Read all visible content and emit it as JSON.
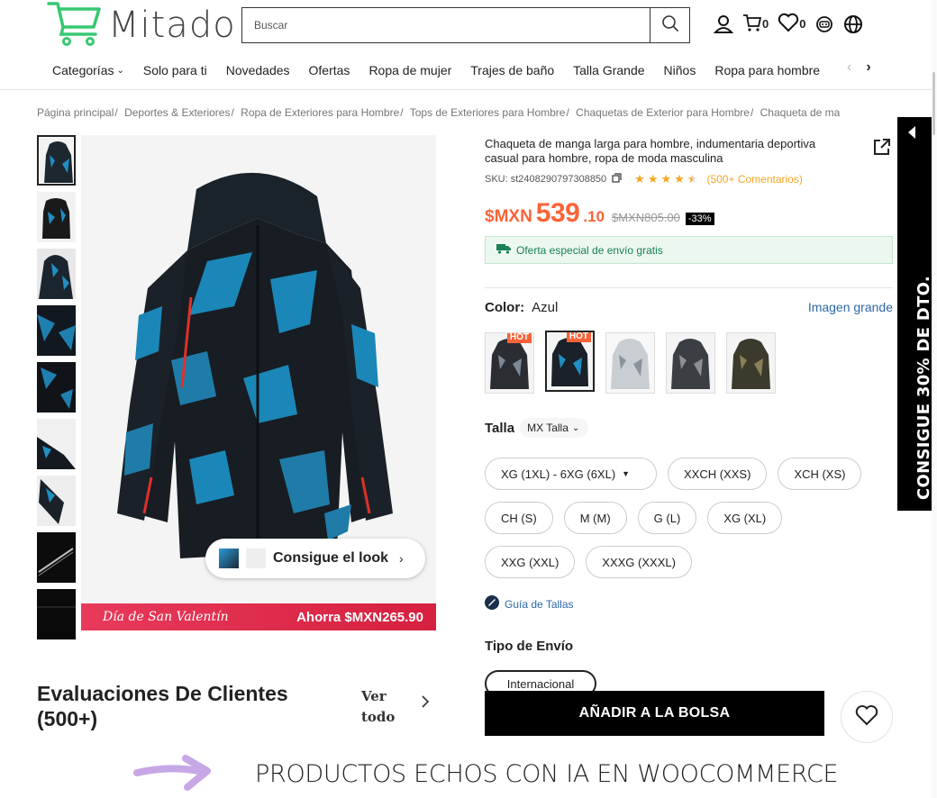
{
  "header": {
    "logo_text": "Mitado",
    "search_placeholder": "Buscar",
    "cart_count": "0",
    "wish_count": "0"
  },
  "nav": {
    "items": [
      "Categorías",
      "Solo para ti",
      "Novedades",
      "Ofertas",
      "Ropa de mujer",
      "Trajes de baño",
      "Talla Grande",
      "Niños",
      "Ropa para hombre"
    ]
  },
  "breadcrumb": [
    "Página principal",
    "Deportes & Exteriores",
    "Ropa de Exteriores para Hombre",
    "Tops de Exteriores para Hombre",
    "Chaquetas de Exterior para Hombre",
    "Chaqueta de ma"
  ],
  "gallery": {
    "promo_left": "Día de San Valentín",
    "promo_right": "Ahorra $MXN265.90",
    "look_label": "Consigue el look"
  },
  "product": {
    "title": "Chaqueta de manga larga para hombre, indumentaria deportiva casual para hombre, ropa de moda masculina",
    "sku": "SKU: st2408290797308850",
    "rating": 4.5,
    "reviews_label": "(500+ Comentarios)",
    "price_currency": "$MXN",
    "price_int": "539",
    "price_dec": ".10",
    "price_old": "$MXN805.00",
    "discount": "-33%",
    "shipping_offer": "Oferta especial de envío gratis",
    "color_label": "Color:",
    "color_value": "Azul",
    "big_image_link": "Imagen grande",
    "hot_badge": "HOT",
    "size_label": "Talla",
    "size_system": "MX Talla",
    "sizes": [
      "XG (1XL) - 6XG (6XL)",
      "XXCH (XXS)",
      "XCH (XS)",
      "CH (S)",
      "M (M)",
      "G (L)",
      "XG (XL)",
      "XXG (XXL)",
      "XXXG (XXXL)"
    ],
    "size_guide": "Guía de Tallas",
    "ship_type_label": "Tipo de Envío",
    "ship_type_value": "Internacional",
    "add_to_bag": "AÑADIR A LA BOLSA"
  },
  "side_tab": {
    "text": "CONSIGUE 30% DE DTO."
  },
  "reviews": {
    "title": "Evaluaciones De Clientes (500+)",
    "see_all": "Ver todo"
  },
  "banner": {
    "text": "PRODUCTOS ECHOS CON IA EN WOOCOMMERCE"
  },
  "colors": {
    "accent": "#fa6338",
    "link": "#2d68a8",
    "star": "#f6a623",
    "ship_green": "#198055",
    "logo_green": "#37c871"
  }
}
